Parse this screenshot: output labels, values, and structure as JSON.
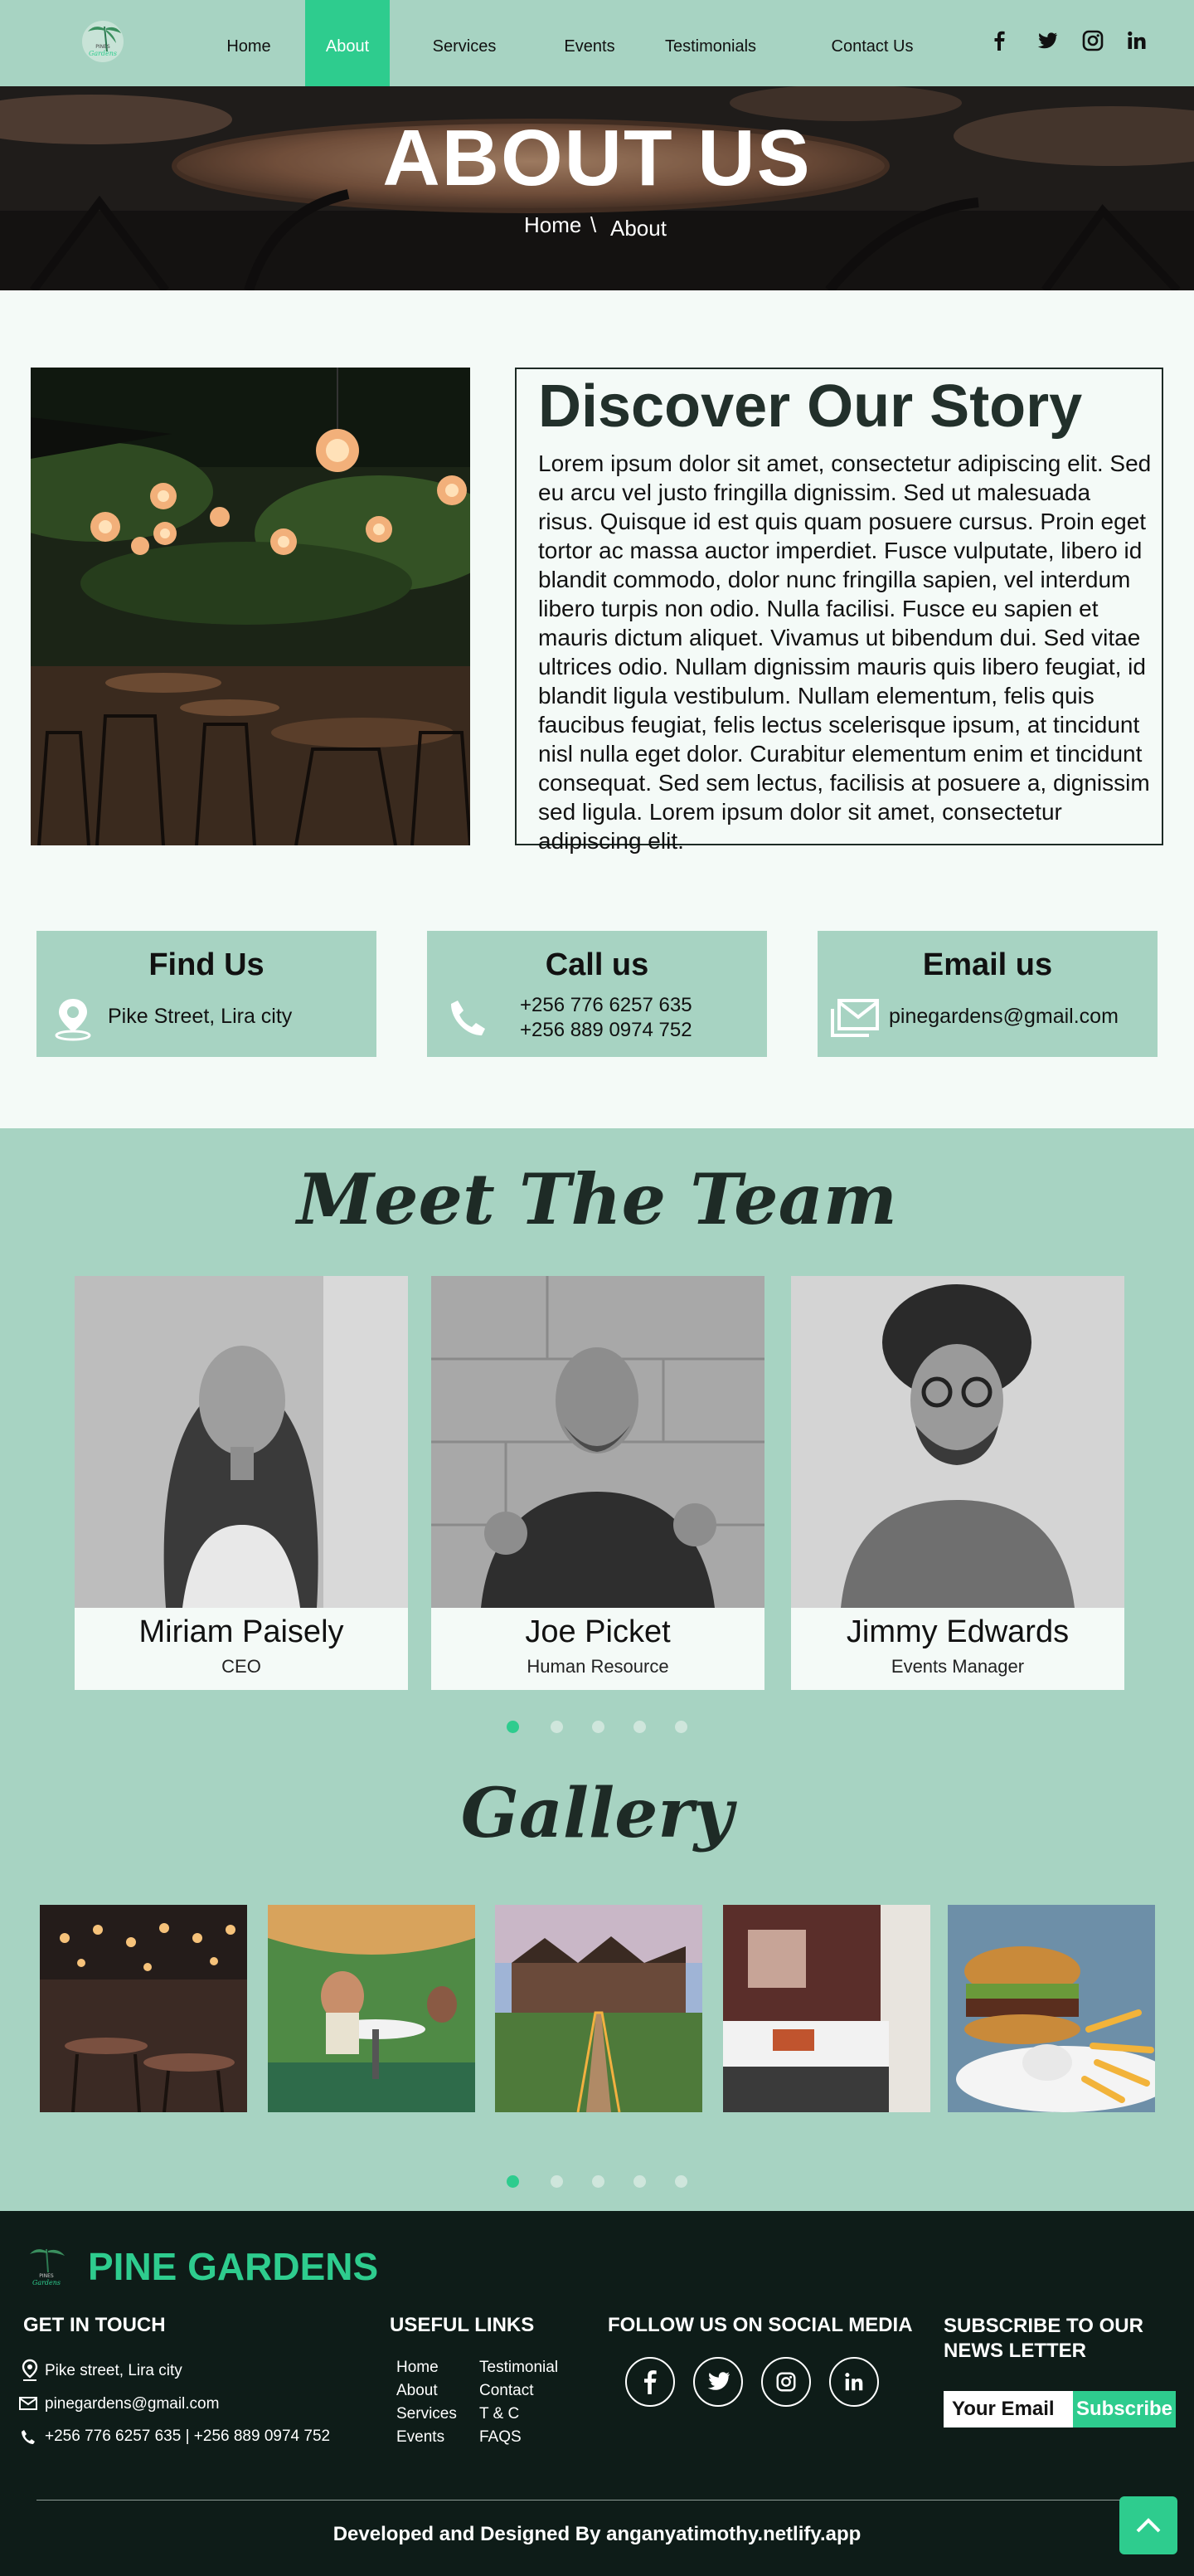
{
  "nav": {
    "items": [
      {
        "label": "Home"
      },
      {
        "label": "About"
      },
      {
        "label": "Services"
      },
      {
        "label": "Events"
      },
      {
        "label": "Testimonials"
      },
      {
        "label": "Contact Us"
      }
    ],
    "active_item": "About",
    "social_icons": [
      "facebook-icon",
      "twitter-icon",
      "instagram-icon",
      "linkedin-icon"
    ]
  },
  "hero": {
    "title": "ABOUT US",
    "breadcrumb_home": "Home",
    "breadcrumb_sep": "\\",
    "breadcrumb_current": "About"
  },
  "story": {
    "heading": "Discover Our Story",
    "body": "Lorem ipsum dolor sit amet, consectetur adipiscing elit. Sed eu arcu vel justo fringilla dignissim. Sed ut malesuada risus. Quisque id est quis quam posuere cursus. Proin eget tortor ac massa auctor imperdiet. Fusce vulputate, libero id blandit commodo, dolor nunc fringilla sapien, vel interdum libero turpis non odio. Nulla facilisi. Fusce eu sapien et mauris dictum aliquet. Vivamus ut bibendum dui. Sed vitae ultrices odio. Nullam dignissim mauris quis libero feugiat, id blandit ligula vestibulum. Nullam elementum, felis quis faucibus feugiat, felis lectus scelerisque ipsum, at tincidunt nisl nulla eget dolor. Curabitur elementum enim et tincidunt consequat. Sed sem lectus, facilisis at posuere a, dignissim sed ligula. Lorem ipsum dolor sit amet, consectetur adipiscing elit."
  },
  "contact_cards": {
    "find": {
      "title": "Find Us",
      "text": "Pike Street, Lira city"
    },
    "call": {
      "title": "Call us",
      "phone1": "+256 776 6257 635",
      "phone2": "+256 889 0974 752"
    },
    "email": {
      "title": "Email us",
      "text": "pinegardens@gmail.com"
    }
  },
  "team": {
    "heading": "Meet The Team",
    "members": [
      {
        "name": "Miriam Paisely",
        "role": "CEO"
      },
      {
        "name": "Joe Picket",
        "role": "Human Resource"
      },
      {
        "name": "Jimmy Edwards",
        "role": "Events Manager"
      }
    ],
    "carousel": {
      "pages": 5,
      "active": 1
    }
  },
  "gallery": {
    "heading": "Gallery",
    "images": [
      "restaurant-night-photo",
      "dining-guest-photo",
      "lodge-building-photo",
      "hotel-room-photo",
      "burger-fries-photo"
    ],
    "carousel": {
      "pages": 5,
      "active": 1
    }
  },
  "footer": {
    "brand": "PINE GARDENS",
    "get_in_touch": {
      "title": "GET IN TOUCH",
      "address": "Pike street, Lira city",
      "email": "pinegardens@gmail.com",
      "phones": "+256 776 6257 635 | +256 889 0974 752"
    },
    "useful_links": {
      "title": "USEFUL LINKS",
      "col1": [
        "Home",
        "About",
        "Services",
        "Events"
      ],
      "col2": [
        "Testimonial",
        "Contact",
        "T & C",
        "FAQS"
      ]
    },
    "social": {
      "title": "FOLLOW US ON SOCIAL MEDIA"
    },
    "newsletter": {
      "title": "SUBSCRIBE TO OUR NEWS LETTER",
      "input_placeholder": "Your Email",
      "button": "Subscribe"
    },
    "credit": "Developed and Designed By anganyatimothy.netlify.app"
  },
  "colors": {
    "nav_bg": "#a7d3c2",
    "accent": "#2ecc8e",
    "footer_bg": "#0e1c18"
  }
}
